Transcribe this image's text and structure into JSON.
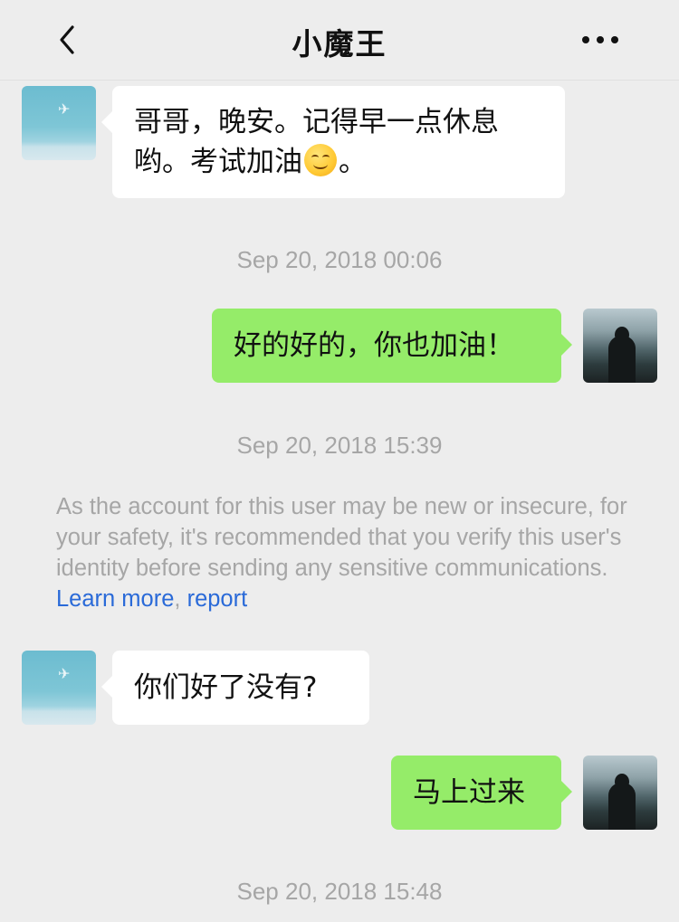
{
  "header": {
    "title": "小魔王",
    "back_icon": "chevron-left-icon",
    "more_icon": "more-dots-icon"
  },
  "messages": [
    {
      "side": "in",
      "text_line1": "哥哥，晚安。记得早一点休息",
      "text_line2_pre": "哟。考试加油",
      "text_line2_post": "。",
      "emoji": "smiling-face-emoji"
    },
    {
      "side": "out",
      "text": "好的好的，你也加油！"
    },
    {
      "side": "in",
      "text": "你们好了没有?"
    },
    {
      "side": "out",
      "text": "马上过来"
    }
  ],
  "timestamps": [
    "Sep 20, 2018 00:06",
    "Sep 20, 2018 15:39",
    "Sep 20, 2018 15:48"
  ],
  "notice": {
    "text": "As the account for this user may be new or insecure, for your safety, it's recommended that you verify this user's identity before sending any sensitive communications. ",
    "learn_more": "Learn more",
    "separator": ", ",
    "report": "report"
  },
  "colors": {
    "background": "#ededed",
    "outgoing_bubble": "#95ec69",
    "incoming_bubble": "#ffffff",
    "link": "#2a6ad8",
    "timestamp": "#a6a6a6"
  }
}
